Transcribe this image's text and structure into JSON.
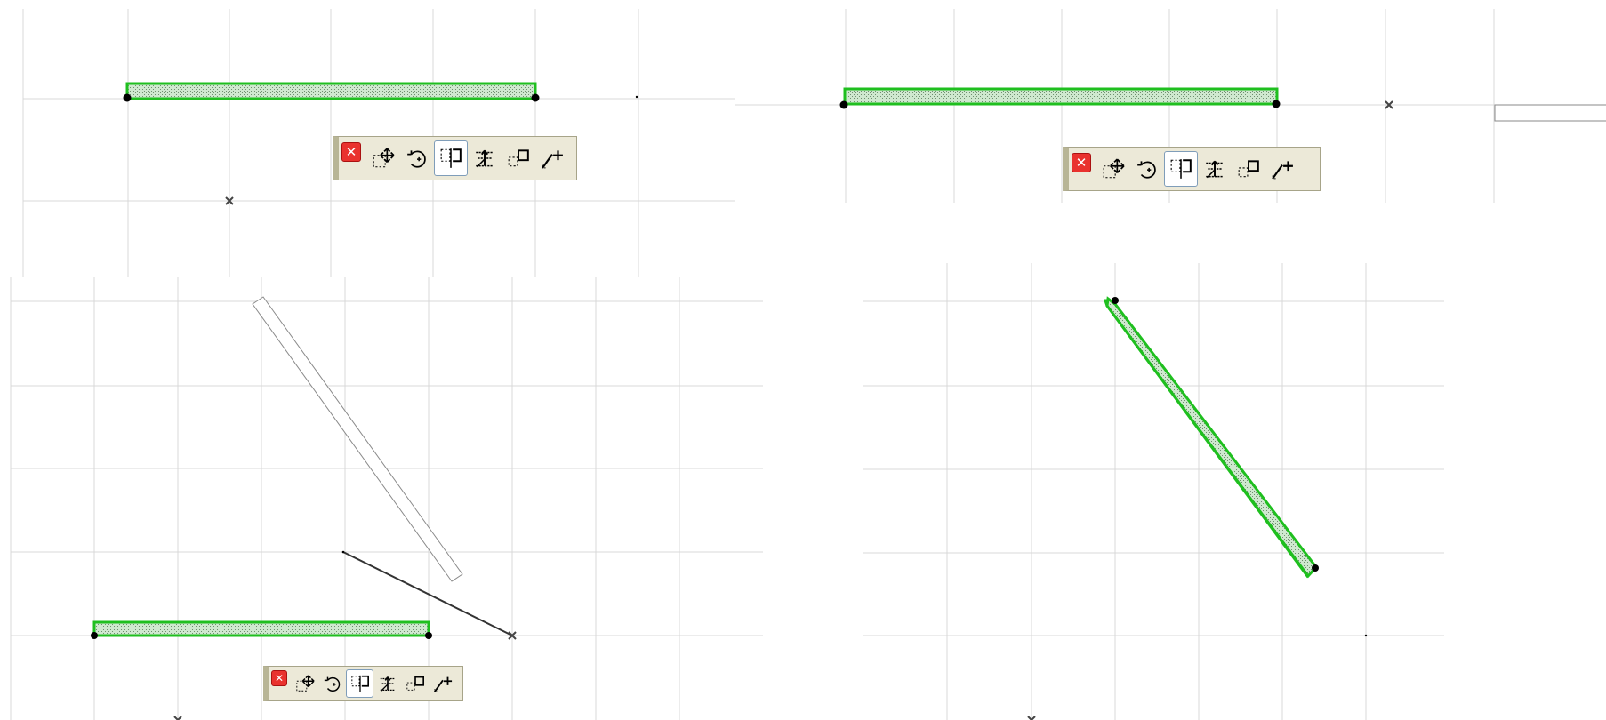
{
  "views": [
    {
      "id": "panel-1",
      "description_free": true
    },
    {
      "id": "panel-2"
    },
    {
      "id": "panel-3"
    },
    {
      "id": "panel-4"
    }
  ],
  "pet_palette": {
    "close_glyph": "✕",
    "commands": [
      {
        "name": "drag",
        "icon": "drag-icon"
      },
      {
        "name": "rotate",
        "icon": "rotate-icon"
      },
      {
        "name": "mirror",
        "icon": "mirror-icon",
        "active": true
      },
      {
        "name": "elevate",
        "icon": "elevate-icon"
      },
      {
        "name": "multiply",
        "icon": "multiply-icon"
      },
      {
        "name": "stretch",
        "icon": "stretch-icon"
      }
    ]
  },
  "colors": {
    "wall_outline": "#1fbf1f",
    "grid": "#d9d9d9",
    "palette_bg": "#ece9d8",
    "close_button": "#e9322e",
    "active_border": "#7f9db9"
  }
}
